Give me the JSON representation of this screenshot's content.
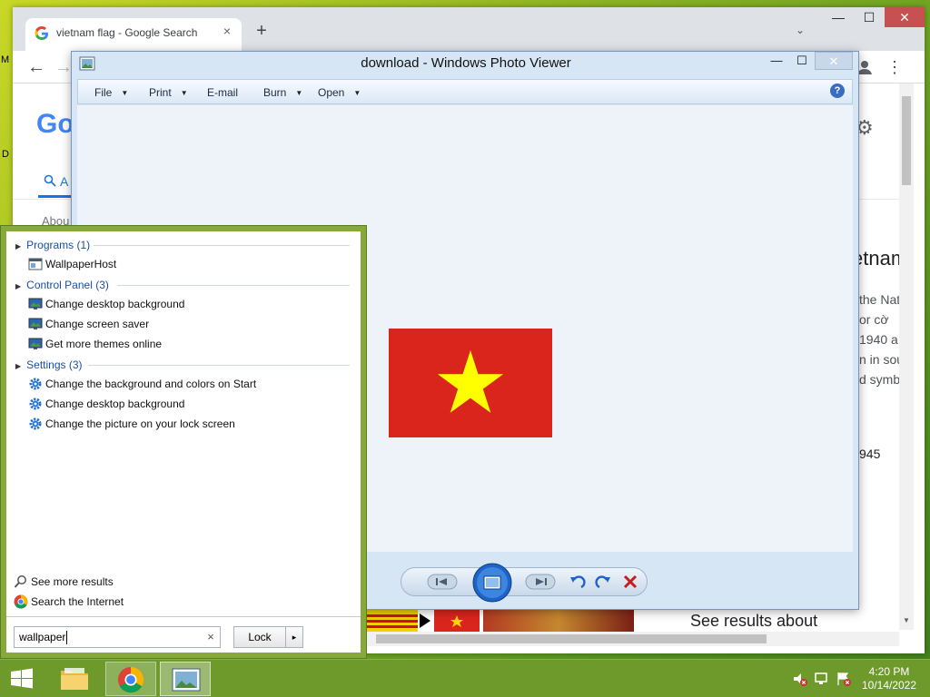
{
  "chrome": {
    "tab_title": "vietnam flag - Google Search",
    "tab_close": "×",
    "new_tab": "+",
    "tab_search": "⌄",
    "min": "—",
    "max": "☐",
    "close": "✕",
    "back": "←",
    "forward": "→",
    "menu": "⋮",
    "google_partial": "Go",
    "tab_all_partial": "A",
    "about_partial": "Abou",
    "knowledge_panel": {
      "title_partial": "etnam",
      "lines": [
        "the Nat",
        "or cờ",
        "1940 a",
        "n in sou",
        "d symbo"
      ],
      "year": "945"
    },
    "see_results": "See results about"
  },
  "photo_viewer": {
    "title": "download - Windows Photo Viewer",
    "menus": [
      "File",
      "Print",
      "E-mail",
      "Burn",
      "Open"
    ],
    "help": "?",
    "min": "—",
    "max": "☐",
    "close": "✕"
  },
  "start_search": {
    "groups": [
      {
        "label": "Programs (1)",
        "items": [
          "WallpaperHost"
        ]
      },
      {
        "label": "Control Panel (3)",
        "items": [
          "Change desktop background",
          "Change screen saver",
          "Get more themes online"
        ]
      },
      {
        "label": "Settings (3)",
        "items": [
          "Change the background and colors on Start",
          "Change desktop background",
          "Change the picture on your lock screen"
        ]
      }
    ],
    "see_more": "See more results",
    "search_internet": "Search the Internet",
    "query": "wallpaper",
    "clear": "×",
    "power_button": "Lock",
    "power_arrow": "▸"
  },
  "taskbar": {
    "time": "4:20 PM",
    "date": "10/14/2022"
  },
  "desktop_stubs": [
    "M",
    "D"
  ],
  "colors": {
    "flag_red": "#da251d",
    "flag_star": "#ffff00",
    "start_accent": "#86a93a",
    "taskbar": "#6e9a2c"
  }
}
